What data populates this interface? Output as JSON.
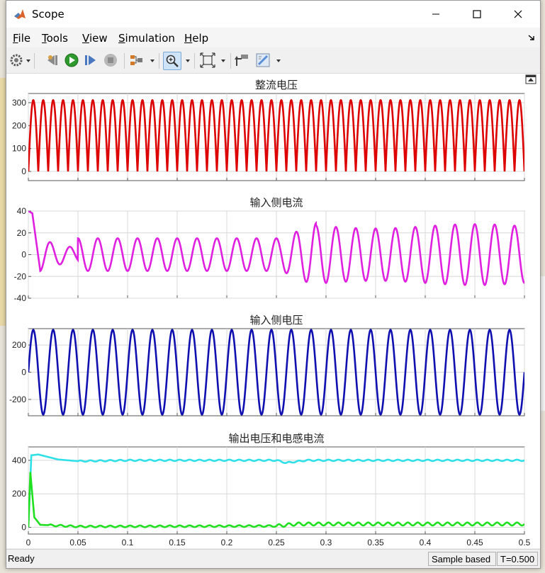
{
  "window": {
    "title": "Scope"
  },
  "menu": [
    {
      "key": "F",
      "rest": "ile"
    },
    {
      "key": "T",
      "rest": "ools"
    },
    {
      "key": "V",
      "rest": "iew"
    },
    {
      "key": "S",
      "rest": "imulation"
    },
    {
      "key": "H",
      "rest": "elp"
    }
  ],
  "toolbar": {
    "icons": [
      "settings-icon",
      "step-back-icon",
      "run-icon",
      "step-forward-icon",
      "stop-icon",
      "signal-selector-icon",
      "zoom-icon",
      "autoscale-icon",
      "highlight-block-icon",
      "style-icon"
    ]
  },
  "colors": {
    "rectified_voltage": "#dd0000",
    "input_current": "#e020e0",
    "input_voltage": "#1010b0",
    "output_voltage": "#30e0e8",
    "inductor_current": "#20e020"
  },
  "chart_data": [
    {
      "type": "line",
      "title": "整流电压",
      "xlim": [
        0,
        0.5
      ],
      "ylim": [
        -40,
        340
      ],
      "yticks": [
        "300",
        "200",
        "100",
        "0"
      ],
      "grid": true,
      "series": [
        {
          "waveform": "full-wave rectified sine",
          "amplitude": 311,
          "frequency_hz": 50,
          "t": [
            0,
            0.5
          ],
          "color": "#dd0000"
        }
      ]
    },
    {
      "type": "line",
      "title": "输入侧电流",
      "xlim": [
        0,
        0.5
      ],
      "ylim": [
        -40,
        40
      ],
      "yticks": [
        "40",
        "20",
        "0",
        "-20",
        "-40"
      ],
      "grid": true,
      "series": [
        {
          "waveform": "sine 50 Hz",
          "points": [
            [
              0,
              40
            ],
            [
              0.004,
              38
            ],
            [
              0.012,
              -15
            ],
            [
              0.025,
              9
            ],
            [
              0.035,
              -6
            ],
            [
              0.045,
              10
            ],
            [
              0.055,
              -15
            ],
            [
              0.1,
              -15
            ],
            [
              0.25,
              14
            ],
            [
              0.25,
              -14
            ],
            [
              0.26,
              18
            ],
            [
              0.28,
              -29
            ],
            [
              0.285,
              29
            ],
            [
              0.5,
              26
            ],
            [
              0.5,
              -26
            ]
          ],
          "amplitude_before_0_25": 15,
          "amplitude_after_0_26": 26,
          "color": "#e020e0"
        }
      ]
    },
    {
      "type": "line",
      "title": "输入侧电压",
      "xlim": [
        0,
        0.5
      ],
      "ylim": [
        -320,
        320
      ],
      "yticks": [
        "200",
        "0",
        "-200"
      ],
      "grid": true,
      "series": [
        {
          "waveform": "sine 50 Hz",
          "amplitude": 311,
          "t": [
            0,
            0.5
          ],
          "color": "#1010b0"
        }
      ]
    },
    {
      "type": "line",
      "title": "输出电压和电感电流",
      "xlim": [
        0,
        0.5
      ],
      "ylim": [
        -40,
        480
      ],
      "yticks": [
        "400",
        "200",
        "0"
      ],
      "xticks": [
        "0",
        "0.05",
        "0.1",
        "0.15",
        "0.2",
        "0.25",
        "0.3",
        "0.35",
        "0.4",
        "0.45",
        "0.5"
      ],
      "grid": true,
      "series": [
        {
          "points": [
            [
              0,
              0
            ],
            [
              0.003,
              430
            ],
            [
              0.01,
              435
            ],
            [
              0.03,
              405
            ],
            [
              0.05,
              395
            ],
            [
              0.1,
              400
            ],
            [
              0.25,
              400
            ],
            [
              0.26,
              385
            ],
            [
              0.28,
              400
            ],
            [
              0.5,
              400
            ]
          ],
          "color": "#30e0e8"
        },
        {
          "points": [
            [
              0,
              0
            ],
            [
              0.002,
              330
            ],
            [
              0.006,
              60
            ],
            [
              0.012,
              15
            ],
            [
              0.05,
              5
            ],
            [
              0.25,
              8
            ],
            [
              0.27,
              20
            ],
            [
              0.5,
              20
            ]
          ],
          "color": "#20e020"
        }
      ]
    }
  ],
  "status": {
    "ready": "Ready",
    "mode": "Sample based",
    "time": "T=0.500"
  }
}
